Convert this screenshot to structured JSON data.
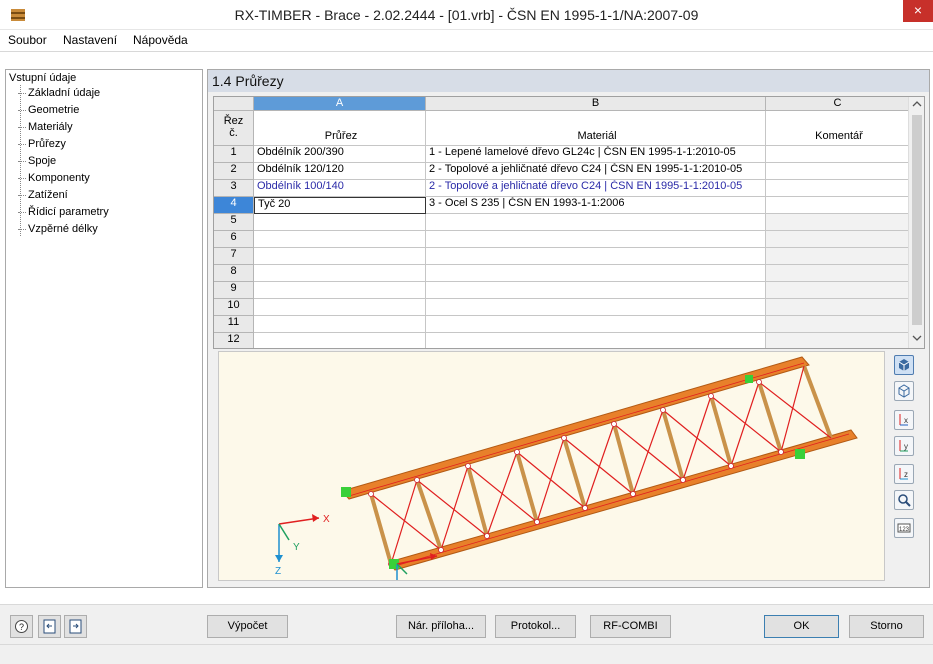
{
  "window": {
    "title": "RX-TIMBER - Brace - 2.02.2444 - [01.vrb] - ČSN EN 1995-1-1/NA:2007-09",
    "close": "×"
  },
  "menu": [
    "Soubor",
    "Nastavení",
    "Nápověda"
  ],
  "nav": {
    "root": "Vstupní údaje",
    "items": [
      "Základní údaje",
      "Geometrie",
      "Materiály",
      "Průřezy",
      "Spoje",
      "Komponenty",
      "Zatížení",
      "Řídicí parametry",
      "Vzpěrné délky"
    ]
  },
  "section_title": "1.4 Průřezy",
  "table": {
    "col_letters": [
      "A",
      "B",
      "C"
    ],
    "rowhdr": "Řez\nč.",
    "col_names": [
      "Průřez",
      "Materiál",
      "Komentář"
    ],
    "rows": [
      {
        "num": "1",
        "section": "Obdélník 200/390",
        "material": "1 - Lepené lamelové dřevo GL24c | ČSN EN 1995-1-1:2010-05",
        "comment": ""
      },
      {
        "num": "2",
        "section": "Obdélník 120/120",
        "material": "2 - Topolové a jehličnaté dřevo C24 | ČSN EN 1995-1-1:2010-05",
        "comment": ""
      },
      {
        "num": "3",
        "section": "Obdélník 100/140",
        "material": "2 - Topolové a jehličnaté dřevo C24 | ČSN EN 1995-1-1:2010-05",
        "comment": ""
      },
      {
        "num": "4",
        "section": "Tyč 20",
        "material": "3 - Ocel S 235 | ČSN EN 1993-1-1:2006",
        "comment": ""
      },
      {
        "num": "5",
        "section": "",
        "material": "",
        "comment": ""
      },
      {
        "num": "6",
        "section": "",
        "material": "",
        "comment": ""
      },
      {
        "num": "7",
        "section": "",
        "material": "",
        "comment": ""
      },
      {
        "num": "8",
        "section": "",
        "material": "",
        "comment": ""
      },
      {
        "num": "9",
        "section": "",
        "material": "",
        "comment": ""
      },
      {
        "num": "10",
        "section": "",
        "material": "",
        "comment": ""
      },
      {
        "num": "11",
        "section": "",
        "material": "",
        "comment": ""
      },
      {
        "num": "12",
        "section": "",
        "material": "",
        "comment": ""
      }
    ]
  },
  "view": {
    "axis_x": "X",
    "axis_y": "Y",
    "axis_z": "Z"
  },
  "toolbar_icons": [
    "view-3d-icon",
    "view-box-icon",
    "view-x-icon",
    "view-y-icon",
    "view-z-icon",
    "reset-view-icon",
    "numbering-icon"
  ],
  "buttons": {
    "calc": "Výpočet",
    "annex": "Nár. příloha...",
    "protocol": "Protokol...",
    "rfcombi": "RF-COMBI",
    "ok": "OK",
    "cancel": "Storno"
  },
  "colors": {
    "beam": "#e8802a",
    "brace": "#e02020",
    "support": "#39d039",
    "selection": "#3d86d8"
  }
}
